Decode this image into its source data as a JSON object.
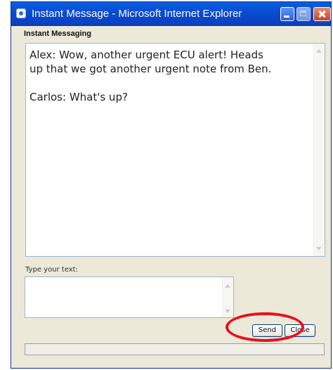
{
  "window": {
    "title": "Instant Message - Microsoft Internet Explorer"
  },
  "section": {
    "title": "Instant Messaging"
  },
  "chat": {
    "message_1_line_1": "Alex: Wow, another urgent ECU alert!  Heads",
    "message_1_line_2": "up that we got another urgent note from Ben.",
    "message_2": "Carlos: What's up?"
  },
  "compose": {
    "label": "Type your text:",
    "value": ""
  },
  "buttons": {
    "send_label": "Send",
    "close_label": "Close"
  },
  "annotation": {
    "highlight_color": "#e8101a"
  }
}
